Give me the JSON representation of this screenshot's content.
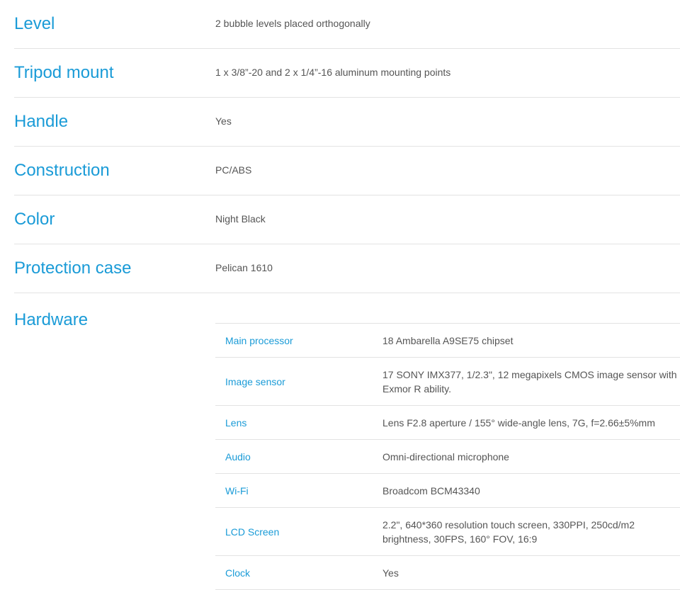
{
  "specs": [
    {
      "label": "Level",
      "value": "2 bubble levels placed orthogonally"
    },
    {
      "label": "Tripod mount",
      "value": "1 x 3/8”-20 and 2 x 1/4”-16 aluminum mounting points"
    },
    {
      "label": "Handle",
      "value": "Yes"
    },
    {
      "label": "Construction",
      "value": "PC/ABS"
    },
    {
      "label": "Color",
      "value": "Night Black"
    },
    {
      "label": "Protection case",
      "value": "Pelican 1610"
    }
  ],
  "hardware": {
    "title": "Hardware",
    "rows": [
      {
        "key": "Main processor",
        "value": "18 Ambarella A9SE75 chipset"
      },
      {
        "key": "Image sensor",
        "value": "17 SONY IMX377, 1/2.3\", 12 megapixels CMOS image sensor with Exmor R ability."
      },
      {
        "key": "Lens",
        "value": "Lens F2.8 aperture / 155° wide-angle lens, 7G, f=2.66±5%mm"
      },
      {
        "key": "Audio",
        "value": "Omni-directional microphone"
      },
      {
        "key": "Wi-Fi",
        "value": "Broadcom BCM43340"
      },
      {
        "key": "LCD Screen",
        "value": "2.2\", 640*360 resolution touch screen, 330PPI, 250cd/m2 brightness, 30FPS, 160° FOV, 16:9"
      },
      {
        "key": "Clock",
        "value": "Yes"
      }
    ]
  }
}
